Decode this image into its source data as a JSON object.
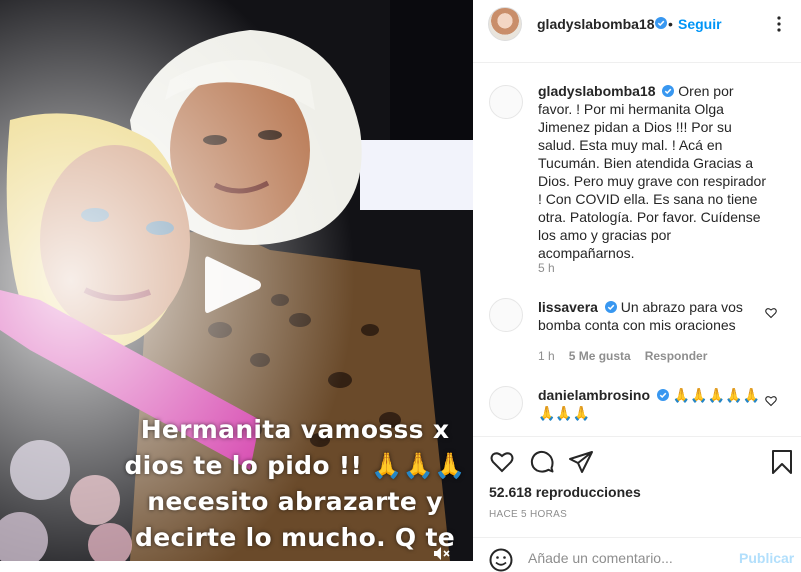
{
  "post": {
    "username": "gladyslabomba18",
    "follow_label": "Seguir",
    "separator": "•",
    "caption": "Oren por favor. ! Por mi hermanita Olga Jimenez pidan a Dios !!! Por su salud. Esta muy mal. ! Acá en Tucumán. Bien atendida Gracias a Dios. Pero muy grave con respirador ! Con COVID ella. Es sana no tiene otra. Patología. Por favor. Cuídense los amo y gracias por acompañarnos.",
    "caption_time": "5 h"
  },
  "video": {
    "overlay_lines": [
      "Hermanita vamosss x",
      "dios te lo pido !! ",
      "necesito abrazarte y",
      "decirte lo mucho. Q te"
    ],
    "overlay_emoji": "🙏🙏🙏"
  },
  "comments": [
    {
      "username": "lissavera",
      "text": "Un abrazo para vos bomba conta con mis oraciones",
      "time": "1 h",
      "likes": "5 Me gusta",
      "reply": "Responder"
    },
    {
      "username": "danielambrosino",
      "text": "🙏🙏🙏🙏🙏🙏🙏🙏",
      "time": "",
      "likes": "",
      "reply": ""
    }
  ],
  "stats": {
    "views": "52.618 reproducciones",
    "posted": "HACE 5 HORAS"
  },
  "comment_box": {
    "placeholder": "Añade un comentario...",
    "publish_label": "Publicar"
  },
  "colors": {
    "accent": "#0095f6",
    "verified": "#3897f0",
    "secondary_text": "#8e8e8e"
  },
  "icons": [
    "play-icon",
    "mute-icon",
    "verified-icon",
    "more-icon",
    "heart-icon",
    "comment-icon",
    "share-icon",
    "bookmark-icon",
    "emoji-icon"
  ]
}
